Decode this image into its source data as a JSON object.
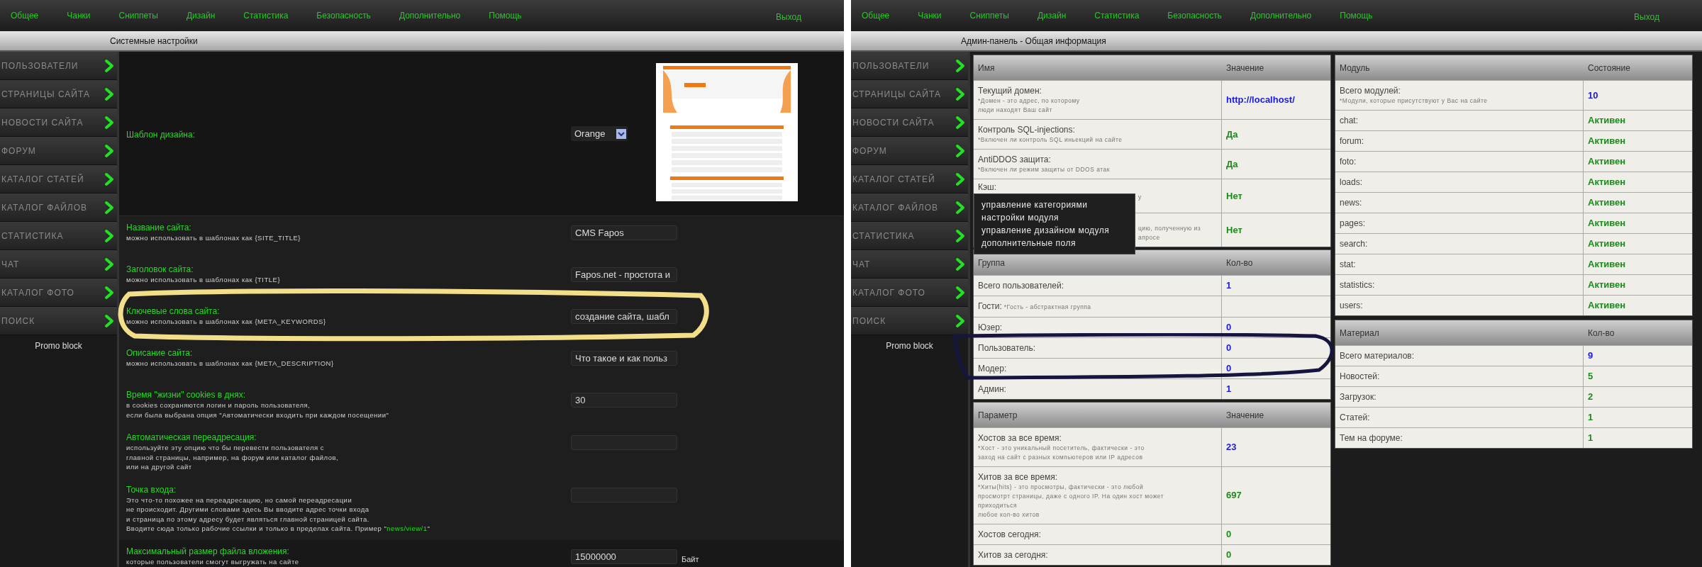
{
  "panels": [
    {
      "kind": "settings",
      "nav": {
        "items": [
          "Общее",
          "Чанки",
          "Сниппеты",
          "Дизайн",
          "Статистика",
          "Безопасность",
          "Дополнительно",
          "Помощь"
        ],
        "logout": "Выход"
      },
      "page_title": "Системные настройки",
      "sidebar": {
        "items": [
          "ПОЛЬЗОВАТЕЛИ",
          "СТРАНИЦЫ САЙТА",
          "НОВОСТИ САЙТА",
          "ФОРУМ",
          "КАТАЛОГ СТАТЕЙ",
          "КАТАЛОГ ФАЙЛОВ",
          "СТАТИСТИКА",
          "ЧАТ",
          "КАТАЛОГ ФОТО",
          "ПОИСК"
        ],
        "promo": "Promo block"
      },
      "settings": [
        {
          "kind": "template",
          "label": "Шаблон дизайна:",
          "select": "Orange"
        },
        {
          "kind": "text",
          "label": "Название сайта:",
          "description": [
            "можно использовать в шаблонах как {SITE_TITLE}"
          ],
          "value": "CMS Fapos"
        },
        {
          "kind": "text",
          "label": "Заголовок сайта:",
          "description": [
            "можно использовать в шаблонах как {TITLE}"
          ],
          "value": "Fapos.net - простота и"
        },
        {
          "kind": "text",
          "label": "Ключевые слова сайта:",
          "description": [
            "можно использовать в шаблонах как {META_KEYWORDS}"
          ],
          "value": "создание сайта, шабл"
        },
        {
          "kind": "text",
          "label": "Описание сайта:",
          "description": [
            "можно использовать в шаблонах как {META_DESCRIPTION}"
          ],
          "value": "Что такое и как польз"
        },
        {
          "kind": "text",
          "label": "Время \"жизни\" cookies в днях:",
          "description": [
            "в cookies сохраняются логин и пароль пользователя,",
            "если была выбрана опция \"Автоматически входить при каждом посещении\""
          ],
          "value": "30"
        },
        {
          "kind": "text",
          "label": "Автоматическая переадресация:",
          "description": [
            "используйте эту опцию что бы перевести пользователя с",
            "главной страницы, например, на форум или каталог файлов,",
            "или на другой сайт"
          ]
        },
        {
          "kind": "text",
          "label": "Точка входа:",
          "description": [
            "Это что-то похожее на переадресацию, но самой переадресации",
            "не происходит. Другими словами здесь Вы вводите адрес точки входа",
            "и страница по этому адресу будет являться главной страницей сайта.",
            "Вводите сюда только рабочие ссылки и только в пределах сайта. Пример \""
          ],
          "example": "news/view/1",
          "example_suffix": "\""
        },
        {
          "kind": "text",
          "label": "Максимальный размер файла вложения:",
          "description": [
            "которые пользователи смогут выгружать на сайте"
          ],
          "value": "15000000",
          "unit": "Байт"
        }
      ]
    },
    {
      "kind": "dashboard",
      "nav": {
        "items": [
          "Общее",
          "Чанки",
          "Сниппеты",
          "Дизайн",
          "Статистика",
          "Безопасность",
          "Дополнительно",
          "Помощь"
        ],
        "logout": "Выход"
      },
      "page_title": "Админ-панель - Общая информация",
      "sidebar": {
        "items": [
          "ПОЛЬЗОВАТЕЛИ",
          "СТРАНИЦЫ САЙТА",
          "НОВОСТИ САЙТА",
          "ФОРУМ",
          "КАТАЛОГ СТАТЕЙ",
          "КАТАЛОГ ФАЙЛОВ",
          "СТАТИСТИКА",
          "ЧАТ",
          "КАТАЛОГ ФОТО",
          "ПОИСК"
        ],
        "promo": "Promo block"
      },
      "popup_menu": {
        "items": [
          "управление категориями",
          "настройки модуля",
          "управление дизайном модуля",
          "дополнительные поля"
        ]
      },
      "left_tables": [
        {
          "columns": [
            "Имя",
            "Значение"
          ],
          "rows": [
            {
              "name": "Текущий домен:",
              "note": [
                "*Домен - это адрес, по которому",
                "люди находят Ваш сайт"
              ],
              "value": "http://localhost/",
              "color": "#1a1adf"
            },
            {
              "name": "Контроль SQL-injections:",
              "note": [
                "*Включен ли контроль SQL иньекций на сайте"
              ],
              "value": "Да",
              "color": "#1c8a1c"
            },
            {
              "name": "AntiDDOS защита:",
              "note": [
                "*Включен ли режим защиты от DDOS атак"
              ],
              "value": "Да",
              "color": "#1c8a1c"
            },
            {
              "name": "Кэш:",
              "note_fragment": [
                "у"
              ],
              "value": "Нет",
              "color": "#1c8a1c"
            },
            {
              "note_fragment": [
                "цию, полученную из",
                "апросе"
              ],
              "value": "Нет",
              "color": "#1c8a1c"
            }
          ]
        },
        {
          "columns": [
            "Группа",
            "Кол-во"
          ],
          "rows": [
            {
              "name": "Всего пользователей:",
              "value": "1",
              "color": "#1a1adf"
            },
            {
              "name": "Гости:",
              "inline_note": "*Гость - абстрактная группа"
            },
            {
              "name": "Юзер:",
              "value": "0",
              "color": "#1a1adf"
            },
            {
              "name": "Пользователь:",
              "value": "0",
              "color": "#1a1adf"
            },
            {
              "name": "Модер:",
              "value": "0",
              "color": "#1a1adf"
            },
            {
              "name": "Админ:",
              "value": "1",
              "color": "#1a1adf"
            }
          ]
        },
        {
          "columns": [
            "Параметр",
            "Значение"
          ],
          "rows": [
            {
              "name": "Хостов за все время:",
              "note": [
                "*Хост - это уникальный посетитель, фактически - это",
                "заход на сайт с разных компьютеров или IP адресов"
              ],
              "value": "23",
              "color": "#1a1adf"
            },
            {
              "name": "Хитов за все время:",
              "note": [
                "*Хиты(hits) - это просмотры, фактически - это любой",
                "просмотрт страницы, даже с одного IP. На один хост может",
                "приходиться",
                "любое кол-во хитов"
              ],
              "value": "697",
              "color": "#1c8a1c"
            },
            {
              "name": "Хостов сегодня:",
              "value": "0",
              "color": "#1c8a1c"
            },
            {
              "name": "Хитов за сегодня:",
              "value": "0",
              "color": "#1c8a1c"
            }
          ]
        }
      ],
      "right_tables": [
        {
          "columns": [
            "Модуль",
            "Состояние"
          ],
          "rows": [
            {
              "name": "Всего модулей:",
              "note": [
                "*Модули, которые присутствуют у Вас на сайте"
              ],
              "value": "10",
              "color": "#1a1adf"
            },
            {
              "name": "chat:",
              "value": "Активен",
              "color": "#1c8a1c"
            },
            {
              "name": "forum:",
              "value": "Активен",
              "color": "#1c8a1c"
            },
            {
              "name": "foto:",
              "value": "Активен",
              "color": "#1c8a1c"
            },
            {
              "name": "loads:",
              "value": "Активен",
              "color": "#1c8a1c"
            },
            {
              "name": "news:",
              "value": "Активен",
              "color": "#1c8a1c"
            },
            {
              "name": "pages:",
              "value": "Активен",
              "color": "#1c8a1c"
            },
            {
              "name": "search:",
              "value": "Активен",
              "color": "#1c8a1c"
            },
            {
              "name": "stat:",
              "value": "Активен",
              "color": "#1c8a1c"
            },
            {
              "name": "statistics:",
              "value": "Активен",
              "color": "#1c8a1c"
            },
            {
              "name": "users:",
              "value": "Активен",
              "color": "#1c8a1c"
            }
          ]
        },
        {
          "columns": [
            "Материал",
            "Кол-во"
          ],
          "rows": [
            {
              "name": "Всего материалов:",
              "value": "9",
              "color": "#1a1adf"
            },
            {
              "name": "Новостей:",
              "value": "5",
              "color": "#1c8a1c"
            },
            {
              "name": "Загрузок:",
              "value": "2",
              "color": "#1c8a1c"
            },
            {
              "name": "Статей:",
              "value": "1",
              "color": "#1c8a1c"
            },
            {
              "name": "Тем на форуме:",
              "value": "1",
              "color": "#1c8a1c"
            }
          ]
        }
      ]
    }
  ]
}
